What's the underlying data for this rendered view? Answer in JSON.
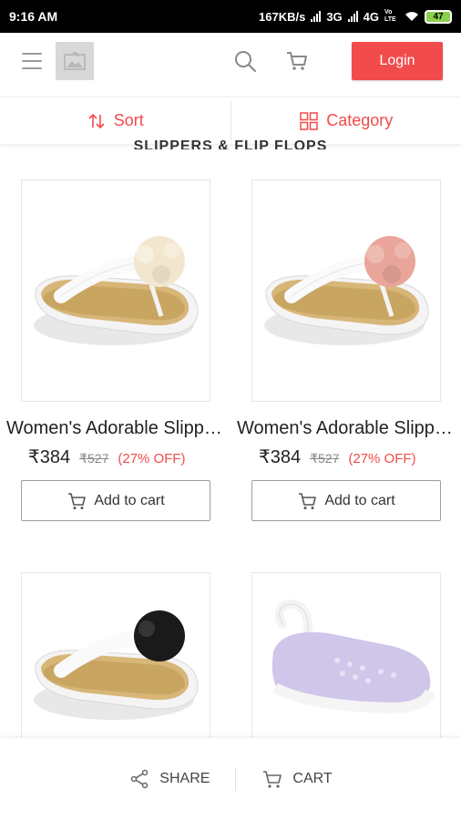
{
  "status_bar": {
    "time": "9:16 AM",
    "network_speed": "167KB/s",
    "network_type_1": "3G",
    "network_type_2": "4G",
    "volte": "Vo LTE",
    "battery": "47"
  },
  "header": {
    "login_label": "Login"
  },
  "filters": {
    "sort_label": "Sort",
    "category_label": "Category"
  },
  "section": {
    "title": "SLIPPERS & FLIP FLOPS"
  },
  "products": [
    {
      "name": "Women's Adorable Slippers",
      "price": "₹384",
      "mrp": "₹527",
      "discount": "(27% OFF)",
      "flower_color": "#f3e6cf",
      "add_to_cart_label": "Add to cart"
    },
    {
      "name": "Women's Adorable Slippers",
      "price": "₹384",
      "mrp": "₹527",
      "discount": "(27% OFF)",
      "flower_color": "#e9a59a",
      "add_to_cart_label": "Add to cart"
    },
    {
      "flower_color": "#1a1a1a"
    },
    {
      "clog_color": "#cfc6ea"
    }
  ],
  "bottom_bar": {
    "share_label": "SHARE",
    "cart_label": "CART"
  },
  "colors": {
    "accent": "#f24b4b"
  }
}
